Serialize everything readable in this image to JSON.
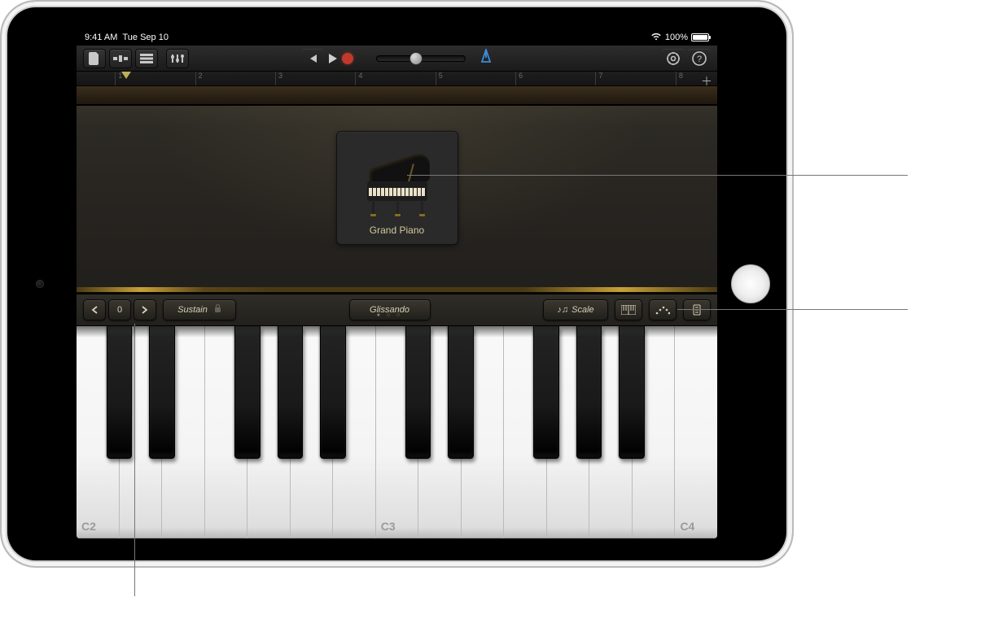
{
  "status": {
    "time": "9:41 AM",
    "date": "Tue Sep 10",
    "battery_pct": "100%"
  },
  "toolbar": {
    "metronome_on": true
  },
  "ruler": {
    "bars": [
      "1",
      "2",
      "3",
      "4",
      "5",
      "6",
      "7",
      "8"
    ]
  },
  "instrument": {
    "name": "Grand Piano"
  },
  "controls": {
    "octave_value": "0",
    "sustain_label": "Sustain",
    "glissando_label": "Glissando",
    "scale_label": "Scale"
  },
  "keyboard": {
    "labels": {
      "c2": "C2",
      "c3": "C3",
      "c4": "C4"
    }
  }
}
